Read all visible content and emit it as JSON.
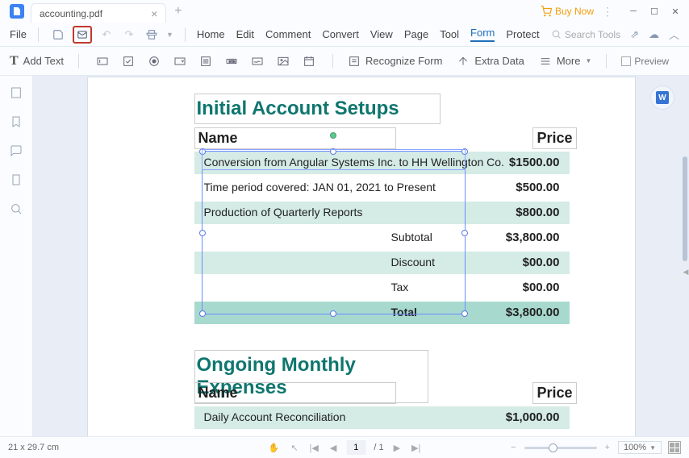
{
  "app": {
    "tab_name": "accounting.pdf",
    "buy_now": "Buy Now"
  },
  "menu": {
    "file": "File",
    "items": [
      "Home",
      "Edit",
      "Comment",
      "Convert",
      "View",
      "Page",
      "Tool",
      "Form",
      "Protect"
    ],
    "active": "Form",
    "search_ph": "Search Tools"
  },
  "toolbar": {
    "add_text": "Add Text",
    "recognize": "Recognize Form",
    "extra_data": "Extra Data",
    "more": "More",
    "preview": "Preview"
  },
  "doc": {
    "h1": "Initial Account Setups",
    "th_name": "Name",
    "th_price": "Price",
    "rows": [
      {
        "name": "Conversion from Angular Systems Inc. to HH Wellington Co.",
        "price": "$1500.00"
      },
      {
        "name": "Time period covered: JAN 01, 2021 to Present",
        "price": "$500.00"
      },
      {
        "name": "Production of Quarterly Reports",
        "price": "$800.00"
      }
    ],
    "summary": {
      "subtotal_l": "Subtotal",
      "subtotal_v": "$3,800.00",
      "discount_l": "Discount",
      "discount_v": "$00.00",
      "tax_l": "Tax",
      "tax_v": "$00.00",
      "total_l": "Total",
      "total_v": "$3,800.00"
    },
    "h2": "Ongoing Monthly Expenses",
    "th2_name": "Name",
    "th2_price": "Price",
    "rows2": [
      {
        "name": "Daily Account Reconciliation",
        "price": "$1,000.00"
      }
    ]
  },
  "status": {
    "dims": "21 x 29.7 cm",
    "page_cur": "1",
    "page_sep": "/ 1",
    "zoom": "100%"
  }
}
